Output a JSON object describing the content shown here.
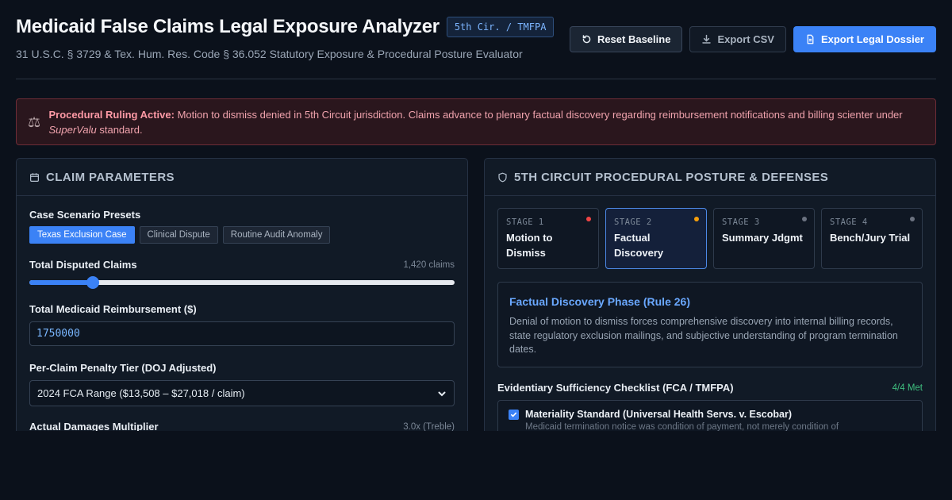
{
  "header": {
    "title": "Medicaid False Claims Legal Exposure Analyzer",
    "badge": "5th Cir. / TMFPA",
    "subtitle": "31 U.S.C. § 3729 & Tex. Hum. Res. Code § 36.052 Statutory Exposure & Procedural Posture Evaluator",
    "buttons": {
      "reset": "Reset Baseline",
      "export_csv": "Export CSV",
      "export_dossier": "Export Legal Dossier"
    }
  },
  "alert": {
    "icon": "scales-icon",
    "lead": "Procedural Ruling Active:",
    "text": "Motion to dismiss denied in 5th Circuit jurisdiction. Claims advance to plenary factual discovery regarding reimbursement notifications and billing scienter under",
    "emphasis": "SuperValu",
    "tail": "standard."
  },
  "claim_panel": {
    "title": "Claim Parameters",
    "presets_label": "Case Scenario Presets",
    "presets": [
      {
        "label": "Texas Exclusion Case",
        "active": true
      },
      {
        "label": "Clinical Dispute",
        "active": false
      },
      {
        "label": "Routine Audit Anomaly",
        "active": false
      }
    ],
    "claims": {
      "label": "Total Disputed Claims",
      "value_text": "1,420 claims",
      "slider_fraction": 0.15
    },
    "reimbursement": {
      "label": "Total Medicaid Reimbursement ($)",
      "value": "1750000"
    },
    "penalty": {
      "label": "Per-Claim Penalty Tier (DOJ Adjusted)",
      "selected": "2024 FCA Range ($13,508 – $27,018 / claim)"
    },
    "multiplier": {
      "label": "Actual Damages Multiplier",
      "value_text": "3.0x (Treble)"
    }
  },
  "posture_panel": {
    "title": "5th Circuit Procedural Posture & Defenses",
    "stages": [
      {
        "num": "STAGE 1",
        "name": "Motion to Dismiss",
        "dot": "#ef4444",
        "active": false
      },
      {
        "num": "STAGE 2",
        "name": "Factual Discovery",
        "dot": "#f59e0b",
        "active": true
      },
      {
        "num": "STAGE 3",
        "name": "Summary Jdgmt",
        "dot": "#6b7280",
        "active": false
      },
      {
        "num": "STAGE 4",
        "name": "Bench/Jury Trial",
        "dot": "#6b7280",
        "active": false
      }
    ],
    "phase": {
      "title": "Factual Discovery Phase (Rule 26)",
      "desc": "Denial of motion to dismiss forces comprehensive discovery into internal billing records, state regulatory exclusion mailings, and subjective understanding of program termination dates."
    },
    "checklist": {
      "title": "Evidentiary Sufficiency Checklist (FCA / TMFPA)",
      "count": "4/4 Met",
      "items": [
        {
          "name": "Materiality Standard (Universal Health Servs. v. Escobar)",
          "desc": "Medicaid termination notice was condition of payment, not merely condition of",
          "checked": true
        }
      ]
    }
  },
  "colors": {
    "accent": "#3b82f6",
    "alert_border": "#6d2c36",
    "success": "#3fbf7f"
  }
}
